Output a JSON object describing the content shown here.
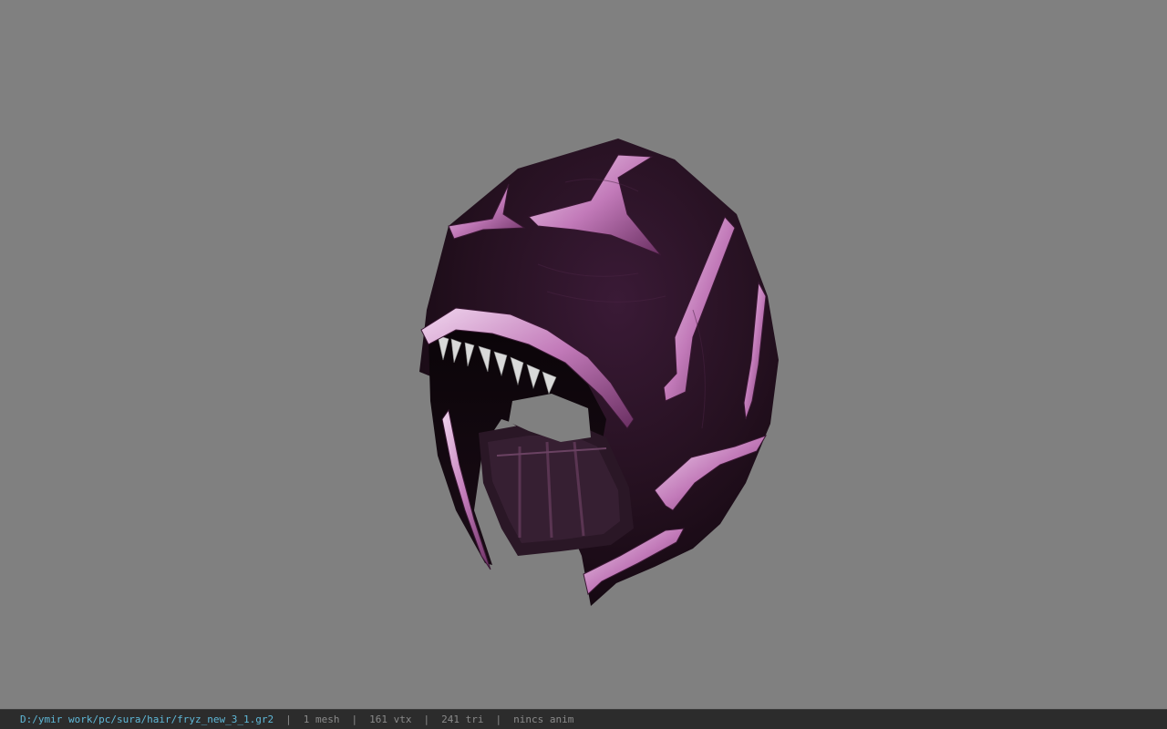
{
  "viewport": {
    "background_color": "#808080",
    "model": {
      "icon": "helmet-model",
      "colors": {
        "base": "#1e0f1e",
        "ridge": "#c77fc0",
        "highlight": "#e8c7e6",
        "teeth": "#d9d9d9"
      }
    }
  },
  "status_bar": {
    "path": "D:/ymir work/pc/sura/hair/fryz_new_3_1.gr2",
    "separator": "|",
    "mesh": "1 mesh",
    "vertices": "161 vtx",
    "triangles": "241 tri",
    "anim": "nincs anim",
    "colors": {
      "background": "#2c2c2c",
      "path": "#5fb8d8",
      "text": "#8a8a8a"
    }
  }
}
